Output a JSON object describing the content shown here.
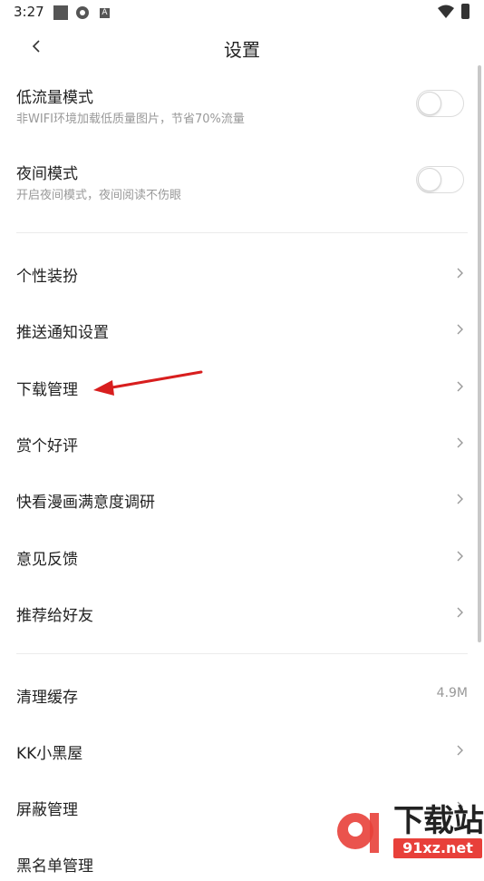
{
  "status_bar": {
    "time": "3:27",
    "icons": [
      "square-icon",
      "settings-icon",
      "a-icon",
      "wifi-icon",
      "battery-icon"
    ]
  },
  "header": {
    "title": "设置"
  },
  "toggles": [
    {
      "label": "低流量模式",
      "sub": "非WIFI环境加载低质量图片，节省70%流量",
      "on": false
    },
    {
      "label": "夜间模式",
      "sub": "开启夜间模式，夜间阅读不伤眼",
      "on": false
    }
  ],
  "menu_group_1": [
    {
      "label": "个性装扮"
    },
    {
      "label": "推送通知设置"
    },
    {
      "label": "下载管理"
    },
    {
      "label": "赏个好评"
    },
    {
      "label": "快看漫画满意度调研"
    },
    {
      "label": "意见反馈"
    },
    {
      "label": "推荐给好友"
    }
  ],
  "menu_group_2": [
    {
      "label": "清理缓存",
      "value": "4.9M"
    },
    {
      "label": "KK小黑屋"
    },
    {
      "label": "屏蔽管理"
    },
    {
      "label": "黑名单管理"
    }
  ],
  "annotation": {
    "arrow_color": "#d81e1e",
    "points_to": "下载管理"
  },
  "watermark": {
    "title": "下载站",
    "url": "91xz.net",
    "brand_color": "#e8403a"
  }
}
